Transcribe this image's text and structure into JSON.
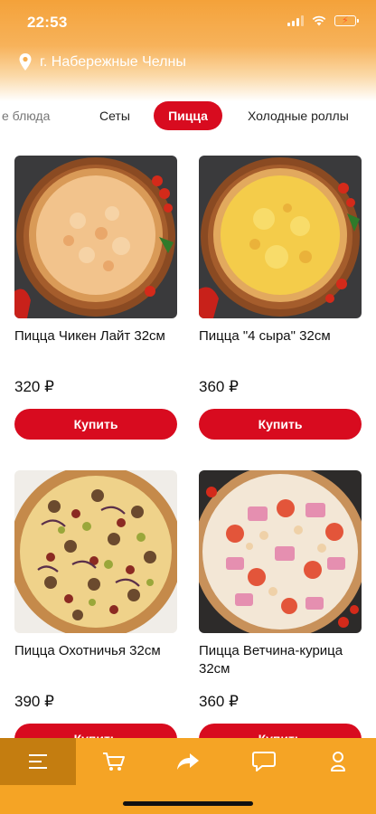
{
  "status_bar": {
    "time": "22:53"
  },
  "location": {
    "city": "г. Набережные Челны"
  },
  "categories": [
    {
      "label": "е блюда"
    },
    {
      "label": "Сеты"
    },
    {
      "label": "Пицца",
      "active": true
    },
    {
      "label": "Холодные роллы"
    }
  ],
  "products": [
    {
      "name": "Пицца Чикен Лайт 32см",
      "price": "320 ₽",
      "button": "Купить"
    },
    {
      "name": "Пицца \"4 сыра\" 32см",
      "price": "360 ₽",
      "button": "Купить"
    },
    {
      "name": "Пицца Охотничья 32см",
      "price": "390 ₽",
      "button": "Купить"
    },
    {
      "name": "Пицца Ветчина-курица 32см",
      "price": "360 ₽",
      "button": "Купить"
    }
  ],
  "bottom_nav": [
    {
      "icon": "menu-icon",
      "active": true
    },
    {
      "icon": "cart-icon"
    },
    {
      "icon": "share-icon"
    },
    {
      "icon": "chat-icon"
    },
    {
      "icon": "profile-icon"
    }
  ],
  "colors": {
    "accent_red": "#d80b1f",
    "nav_orange": "#f5a425",
    "nav_active": "#c47d10"
  }
}
